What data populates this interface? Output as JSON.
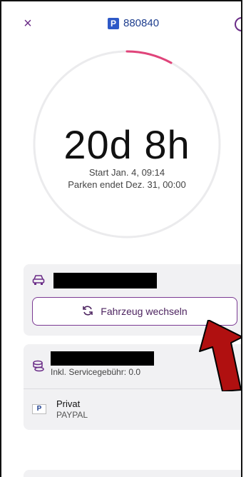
{
  "header": {
    "close_symbol": "×",
    "zone_badge": "P",
    "zone_number": "880840",
    "info_symbol": "i"
  },
  "session": {
    "duration": "20d 8h",
    "start_text": "Start Jan. 4, 09:14",
    "end_text": "Parken endet Dez. 31, 00:00"
  },
  "vehicle": {
    "switch_label": "Fahrzeug wechseln"
  },
  "payment": {
    "fee_text": "Inkl. Servicegebühr: 0.0",
    "method_name": "Privat",
    "method_type": "PAYPAL"
  },
  "colors": {
    "accent": "#6a2c87",
    "progress": "#e0447a",
    "zone_blue": "#2e59c7",
    "annotation_arrow": "#b01010"
  }
}
